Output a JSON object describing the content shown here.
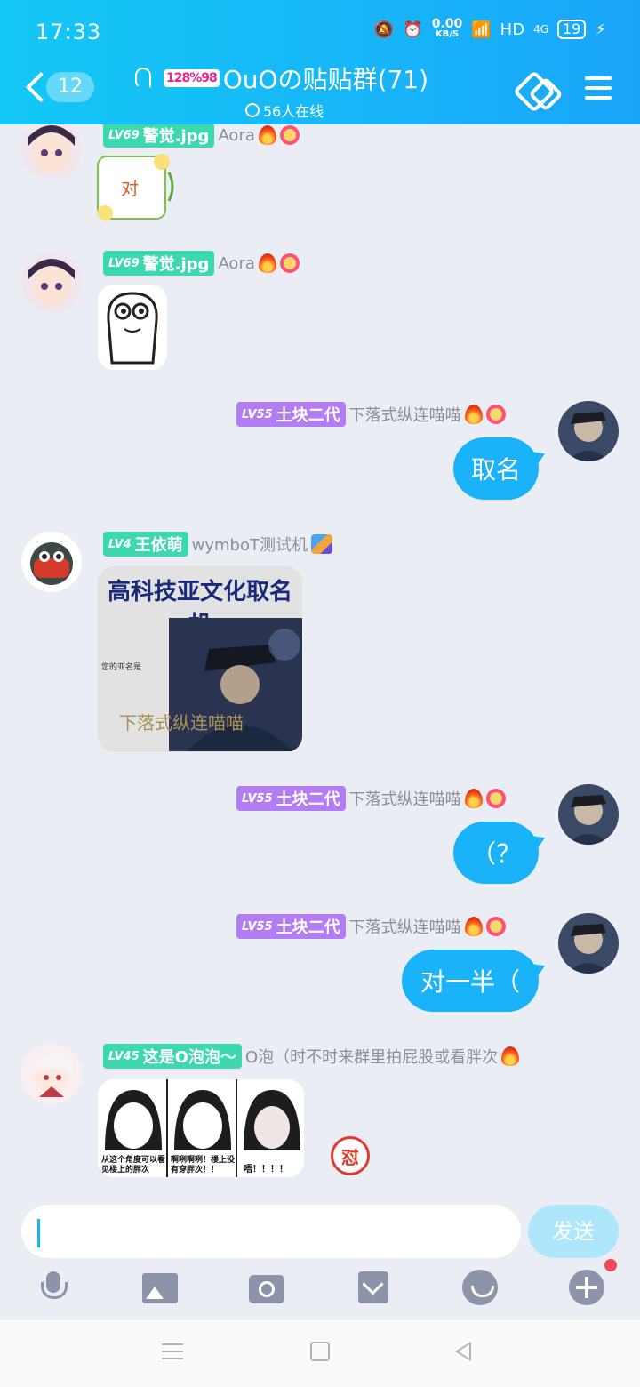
{
  "status_bar": {
    "time": "17:33",
    "speed_value": "0.00",
    "speed_unit": "KB/S",
    "hd": "HD",
    "net": "4G",
    "battery": "19"
  },
  "header": {
    "unread_count": "12",
    "group_logo": "128%98",
    "group_name": "OuOの贴贴群(71)",
    "online_text": "56人在线"
  },
  "messages": [
    {
      "side": "left",
      "level": "LV69",
      "badge": "警觉.jpg",
      "name": "Aora",
      "content_type": "sticker",
      "sticker_text": "对"
    },
    {
      "side": "left",
      "level": "LV69",
      "badge": "警觉.jpg",
      "name": "Aora",
      "content_type": "sticker"
    },
    {
      "side": "right",
      "level": "LV55",
      "badge": "土块二代",
      "name": "下落式纵连喵喵",
      "text": "取名"
    },
    {
      "side": "left",
      "level": "LV4",
      "badge": "王依萌",
      "name": "wymboT测试机",
      "content_type": "image",
      "image_title": "高科技亚文化取名机",
      "image_label": "您的亚名是",
      "image_result": "下落式纵连喵喵"
    },
    {
      "side": "right",
      "level": "LV55",
      "badge": "土块二代",
      "name": "下落式纵连喵喵",
      "text": "（？"
    },
    {
      "side": "right",
      "level": "LV55",
      "badge": "土块二代",
      "name": "下落式纵连喵喵",
      "text": "对一半（"
    },
    {
      "side": "left",
      "level": "LV45",
      "badge": "这是O泡泡～",
      "name": "O泡（时不时来群里拍屁股或看胖次",
      "content_type": "image",
      "panel_1": "从这个角度可以看见楼上的胖次",
      "panel_2": "啊咧啊咧！楼上没有穿胖次！！",
      "panel_3": "唔！！！！",
      "reaction": "怼"
    }
  ],
  "input": {
    "placeholder": "",
    "send_label": "发送"
  },
  "icons": [
    "mic-icon",
    "image-icon",
    "camera-icon",
    "envelope-icon",
    "smile-icon",
    "plus-icon"
  ],
  "colors": {
    "accent": "#1ab2f8",
    "header_start": "#14c8f5",
    "badge_green": "#3ed8b0",
    "badge_purple": "#b27cf2"
  }
}
